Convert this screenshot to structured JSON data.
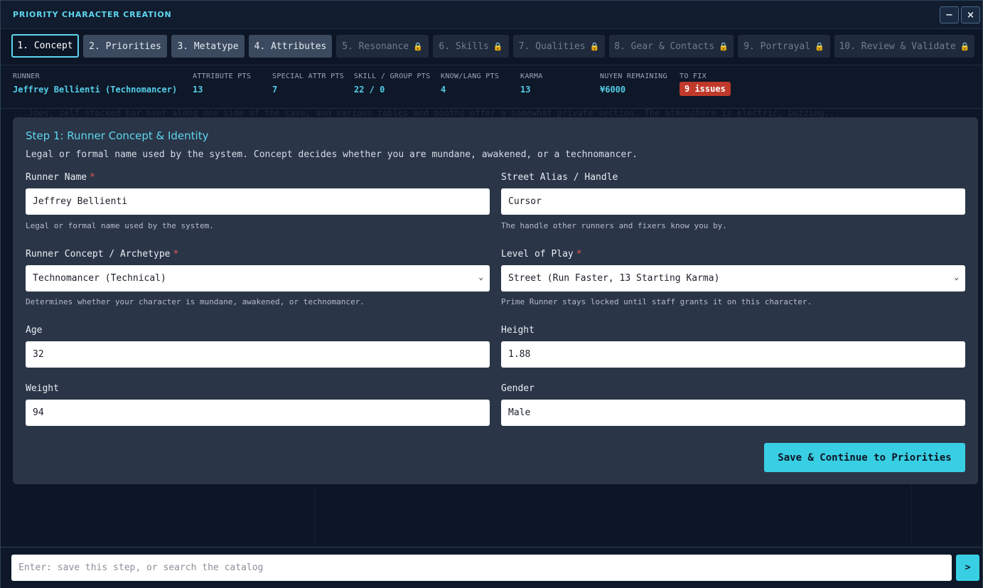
{
  "window": {
    "title": "PRIORITY CHARACTER CREATION",
    "minimize": "−",
    "close": "×"
  },
  "tabs": [
    {
      "label": "1. Concept",
      "state": "active"
    },
    {
      "label": "2. Priorities",
      "state": "done"
    },
    {
      "label": "3. Metatype",
      "state": "done"
    },
    {
      "label": "4. Attributes",
      "state": "done"
    },
    {
      "label": "5. Resonance",
      "state": "locked"
    },
    {
      "label": "6. Skills",
      "state": "locked"
    },
    {
      "label": "7. Qualities",
      "state": "locked"
    },
    {
      "label": "8. Gear & Contacts",
      "state": "locked"
    },
    {
      "label": "9. Portrayal",
      "state": "locked"
    },
    {
      "label": "10. Review & Validate",
      "state": "locked"
    }
  ],
  "stats": {
    "runner": {
      "label": "RUNNER",
      "value": "Jeffrey Bellienti (Technomancer)"
    },
    "attribute_pts": {
      "label": "ATTRIBUTE PTS",
      "value": "13"
    },
    "special_attr_pts": {
      "label": "SPECIAL ATTR PTS",
      "value": "7"
    },
    "skill_group_pts": {
      "label": "SKILL / GROUP PTS",
      "value": "22 / 0"
    },
    "know_lang_pts": {
      "label": "KNOW/LANG PTS",
      "value": "4"
    },
    "karma": {
      "label": "KARMA",
      "value": "13"
    },
    "nuyen": {
      "label": "NUYEN REMAINING",
      "value": "¥6000"
    },
    "to_fix": {
      "label": "TO FIX",
      "value": "9 issues"
    }
  },
  "background_text": "...Joes, self-stocked bar over along one side of the cave, and various tables and booths offer a somewhat private section. The atmosphere is electric, buzzing...",
  "step": {
    "title": "Step 1: Runner Concept & Identity",
    "description": "Legal or formal name used by the system. Concept decides whether you are mundane, awakened, or a technomancer."
  },
  "fields": {
    "runner_name": {
      "label": "Runner Name",
      "required": "*",
      "value": "Jeffrey Bellienti",
      "hint": "Legal or formal name used by the system."
    },
    "street_alias": {
      "label": "Street Alias / Handle",
      "value": "Cursor",
      "hint": "The handle other runners and fixers know you by."
    },
    "concept": {
      "label": "Runner Concept / Archetype",
      "required": "*",
      "value": "Technomancer (Technical)",
      "hint": "Determines whether your character is mundane, awakened, or technomancer."
    },
    "level": {
      "label": "Level of Play",
      "required": "*",
      "value": "Street (Run Faster, 13 Starting Karma)",
      "hint": "Prime Runner stays locked until staff grants it on this character."
    },
    "age": {
      "label": "Age",
      "value": "32"
    },
    "height": {
      "label": "Height",
      "value": "1.88"
    },
    "weight": {
      "label": "Weight",
      "value": "94"
    },
    "gender": {
      "label": "Gender",
      "value": "Male"
    }
  },
  "save_button": "Save & Continue to Priorities",
  "command": {
    "placeholder": "Enter: save this step, or search the catalog",
    "go": ">"
  },
  "colors": {
    "accent": "#38cfe4",
    "danger": "#c0392b",
    "lock": "#c98a45"
  }
}
